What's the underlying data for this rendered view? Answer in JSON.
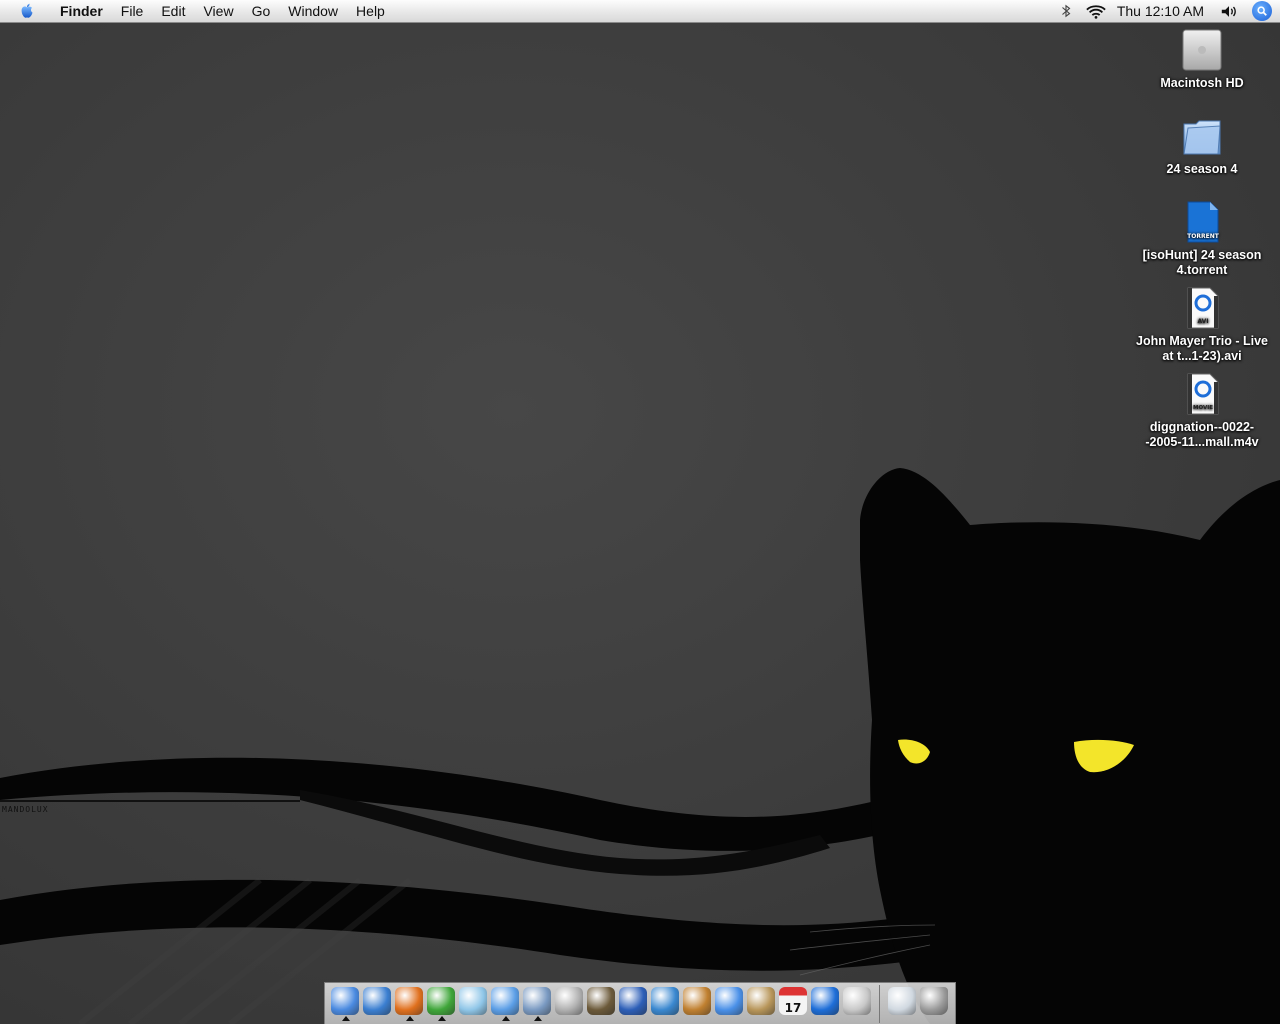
{
  "menubar": {
    "app_name": "Finder",
    "items": [
      {
        "label": "File"
      },
      {
        "label": "Edit"
      },
      {
        "label": "View"
      },
      {
        "label": "Go"
      },
      {
        "label": "Window"
      },
      {
        "label": "Help"
      }
    ],
    "status": {
      "clock": "Thu 12:10 AM",
      "icons": [
        "bluetooth-icon",
        "wifi-icon",
        "volume-icon",
        "spotlight-icon"
      ]
    }
  },
  "desktop": {
    "watermark": "MANDOLUX",
    "icons": [
      {
        "name": "macintosh-hd",
        "label": "Macintosh HD",
        "type": "hard-drive-icon"
      },
      {
        "name": "folder-24-season-4",
        "label": "24 season 4",
        "type": "folder-icon"
      },
      {
        "name": "torrent-file",
        "label": "[isoHunt] 24 season 4.torrent",
        "type": "torrent-file-icon",
        "badge": "TORRENT"
      },
      {
        "name": "avi-file",
        "label": "John Mayer Trio - Live at t...1-23).avi",
        "type": "quicktime-movie-icon",
        "badge": "AVI"
      },
      {
        "name": "m4v-file",
        "label": "diggnation--0022--2005-11...mall.m4v",
        "type": "quicktime-movie-icon",
        "badge": "MOVIE"
      }
    ]
  },
  "dock": {
    "apps": [
      {
        "name": "finder",
        "icon": "finder-icon",
        "color": "#4a8ae0",
        "running": true
      },
      {
        "name": "safari",
        "icon": "safari-icon",
        "color": "#3b7fd1",
        "running": false
      },
      {
        "name": "firefox",
        "icon": "firefox-icon",
        "color": "#e0701e",
        "running": true
      },
      {
        "name": "adium",
        "icon": "adium-duck-icon",
        "color": "#3fa63a",
        "running": true
      },
      {
        "name": "itunes",
        "icon": "itunes-icon",
        "color": "#8fc6e8",
        "running": false
      },
      {
        "name": "app-store-box",
        "icon": "box-icon",
        "color": "#5b9ee6",
        "running": true
      },
      {
        "name": "mail",
        "icon": "mail-icon",
        "color": "#7a9ac2",
        "running": true
      },
      {
        "name": "dvd-player",
        "icon": "dvd-icon",
        "color": "#b0b0b0",
        "running": false
      },
      {
        "name": "iphoto",
        "icon": "iphoto-icon",
        "color": "#6c5a3a",
        "running": false
      },
      {
        "name": "imovie",
        "icon": "imovie-icon",
        "color": "#2d5fb8",
        "running": false
      },
      {
        "name": "idvd",
        "icon": "idvd-icon",
        "color": "#3a88d0",
        "running": false
      },
      {
        "name": "garageband",
        "icon": "guitar-icon",
        "color": "#c08030",
        "running": false
      },
      {
        "name": "ichat",
        "icon": "ichat-icon",
        "color": "#4a90e8",
        "running": false
      },
      {
        "name": "address-book",
        "icon": "address-book-icon",
        "color": "#b8965a",
        "running": false
      },
      {
        "name": "ical",
        "icon": "calendar-icon",
        "color": "#e8e8e8",
        "running": false,
        "text": "17"
      },
      {
        "name": "quicktime",
        "icon": "quicktime-icon",
        "color": "#1e6ed8",
        "running": false
      },
      {
        "name": "system-preferences",
        "icon": "apple-prefs-icon",
        "color": "#c8c8c8",
        "running": false
      }
    ],
    "right": [
      {
        "name": "downloads-window",
        "icon": "window-icon",
        "color": "#d0d8e0"
      },
      {
        "name": "trash",
        "icon": "trash-icon",
        "color": "#9a9a9a"
      }
    ]
  }
}
